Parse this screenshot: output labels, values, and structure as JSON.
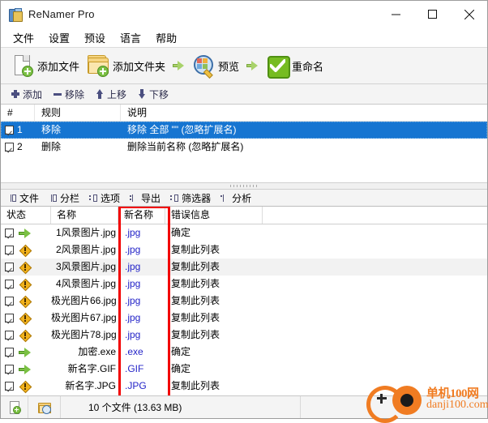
{
  "window": {
    "title": "ReNamer Pro",
    "icon": "app-folder-icon",
    "minimize": "−",
    "maximize": "□",
    "close": "✕"
  },
  "menu": [
    {
      "label": "文件"
    },
    {
      "label": "设置"
    },
    {
      "label": "预设"
    },
    {
      "label": "语言"
    },
    {
      "label": "帮助"
    }
  ],
  "toolbar": {
    "add_files": "添加文件",
    "add_folder": "添加文件夹",
    "preview": "预览",
    "rename": "重命名"
  },
  "rules_toolbar": [
    {
      "label": "添加",
      "icon": "plus-icon"
    },
    {
      "label": "移除",
      "icon": "minus-icon"
    },
    {
      "label": "上移",
      "icon": "arrow-up-icon"
    },
    {
      "label": "下移",
      "icon": "arrow-down-icon"
    }
  ],
  "rules_table": {
    "columns": [
      "#",
      "规则",
      "说明"
    ],
    "rows": [
      {
        "checked": true,
        "num": "1",
        "rule": "移除",
        "desc": "移除 全部 \"\" (忽略扩展名)",
        "selected": true
      },
      {
        "checked": true,
        "num": "2",
        "rule": "删除",
        "desc": "删除当前名称 (忽略扩展名)",
        "selected": false
      }
    ]
  },
  "tabs": [
    {
      "label": "文件",
      "icon": "columns-icon"
    },
    {
      "label": "分栏",
      "icon": "columns-icon"
    },
    {
      "label": "选项",
      "icon": "options-icon"
    },
    {
      "label": "导出",
      "icon": "export-icon"
    },
    {
      "label": "筛选器",
      "icon": "filter-icon"
    },
    {
      "label": "分析",
      "icon": "analyze-icon"
    }
  ],
  "files_table": {
    "columns": [
      "状态",
      "名称",
      "新名称",
      "错误信息"
    ],
    "highlight_column": "新名称",
    "highlight_color": "#f20000",
    "rows": [
      {
        "checked": true,
        "status": "ok",
        "name": "1风景图片.jpg",
        "newname": ".jpg",
        "error": "确定"
      },
      {
        "checked": true,
        "status": "warn",
        "name": "2风景图片.jpg",
        "newname": ".jpg",
        "error": "复制此列表"
      },
      {
        "checked": true,
        "status": "warn",
        "name": "3风景图片.jpg",
        "newname": ".jpg",
        "error": "复制此列表",
        "alt": true
      },
      {
        "checked": true,
        "status": "warn",
        "name": "4风景图片.jpg",
        "newname": ".jpg",
        "error": "复制此列表"
      },
      {
        "checked": true,
        "status": "warn",
        "name": "极光图片66.jpg",
        "newname": ".jpg",
        "error": "复制此列表"
      },
      {
        "checked": true,
        "status": "warn",
        "name": "极光图片67.jpg",
        "newname": ".jpg",
        "error": "复制此列表"
      },
      {
        "checked": true,
        "status": "warn",
        "name": "极光图片78.jpg",
        "newname": ".jpg",
        "error": "复制此列表"
      },
      {
        "checked": true,
        "status": "ok",
        "name": "加密.exe",
        "newname": ".exe",
        "error": "确定"
      },
      {
        "checked": true,
        "status": "ok",
        "name": "新名字.GIF",
        "newname": ".GIF",
        "error": "确定"
      },
      {
        "checked": true,
        "status": "warn",
        "name": "新名字.JPG",
        "newname": ".JPG",
        "error": "复制此列表"
      }
    ]
  },
  "statusbar": {
    "add_file_icon": "file-add-icon",
    "browse_icon": "folder-search-icon",
    "files_count": "10 个文件 (13.63 MB)"
  },
  "watermark": {
    "line1": "单机100网",
    "line2": "danji100.com",
    "color": "#f07c22"
  }
}
